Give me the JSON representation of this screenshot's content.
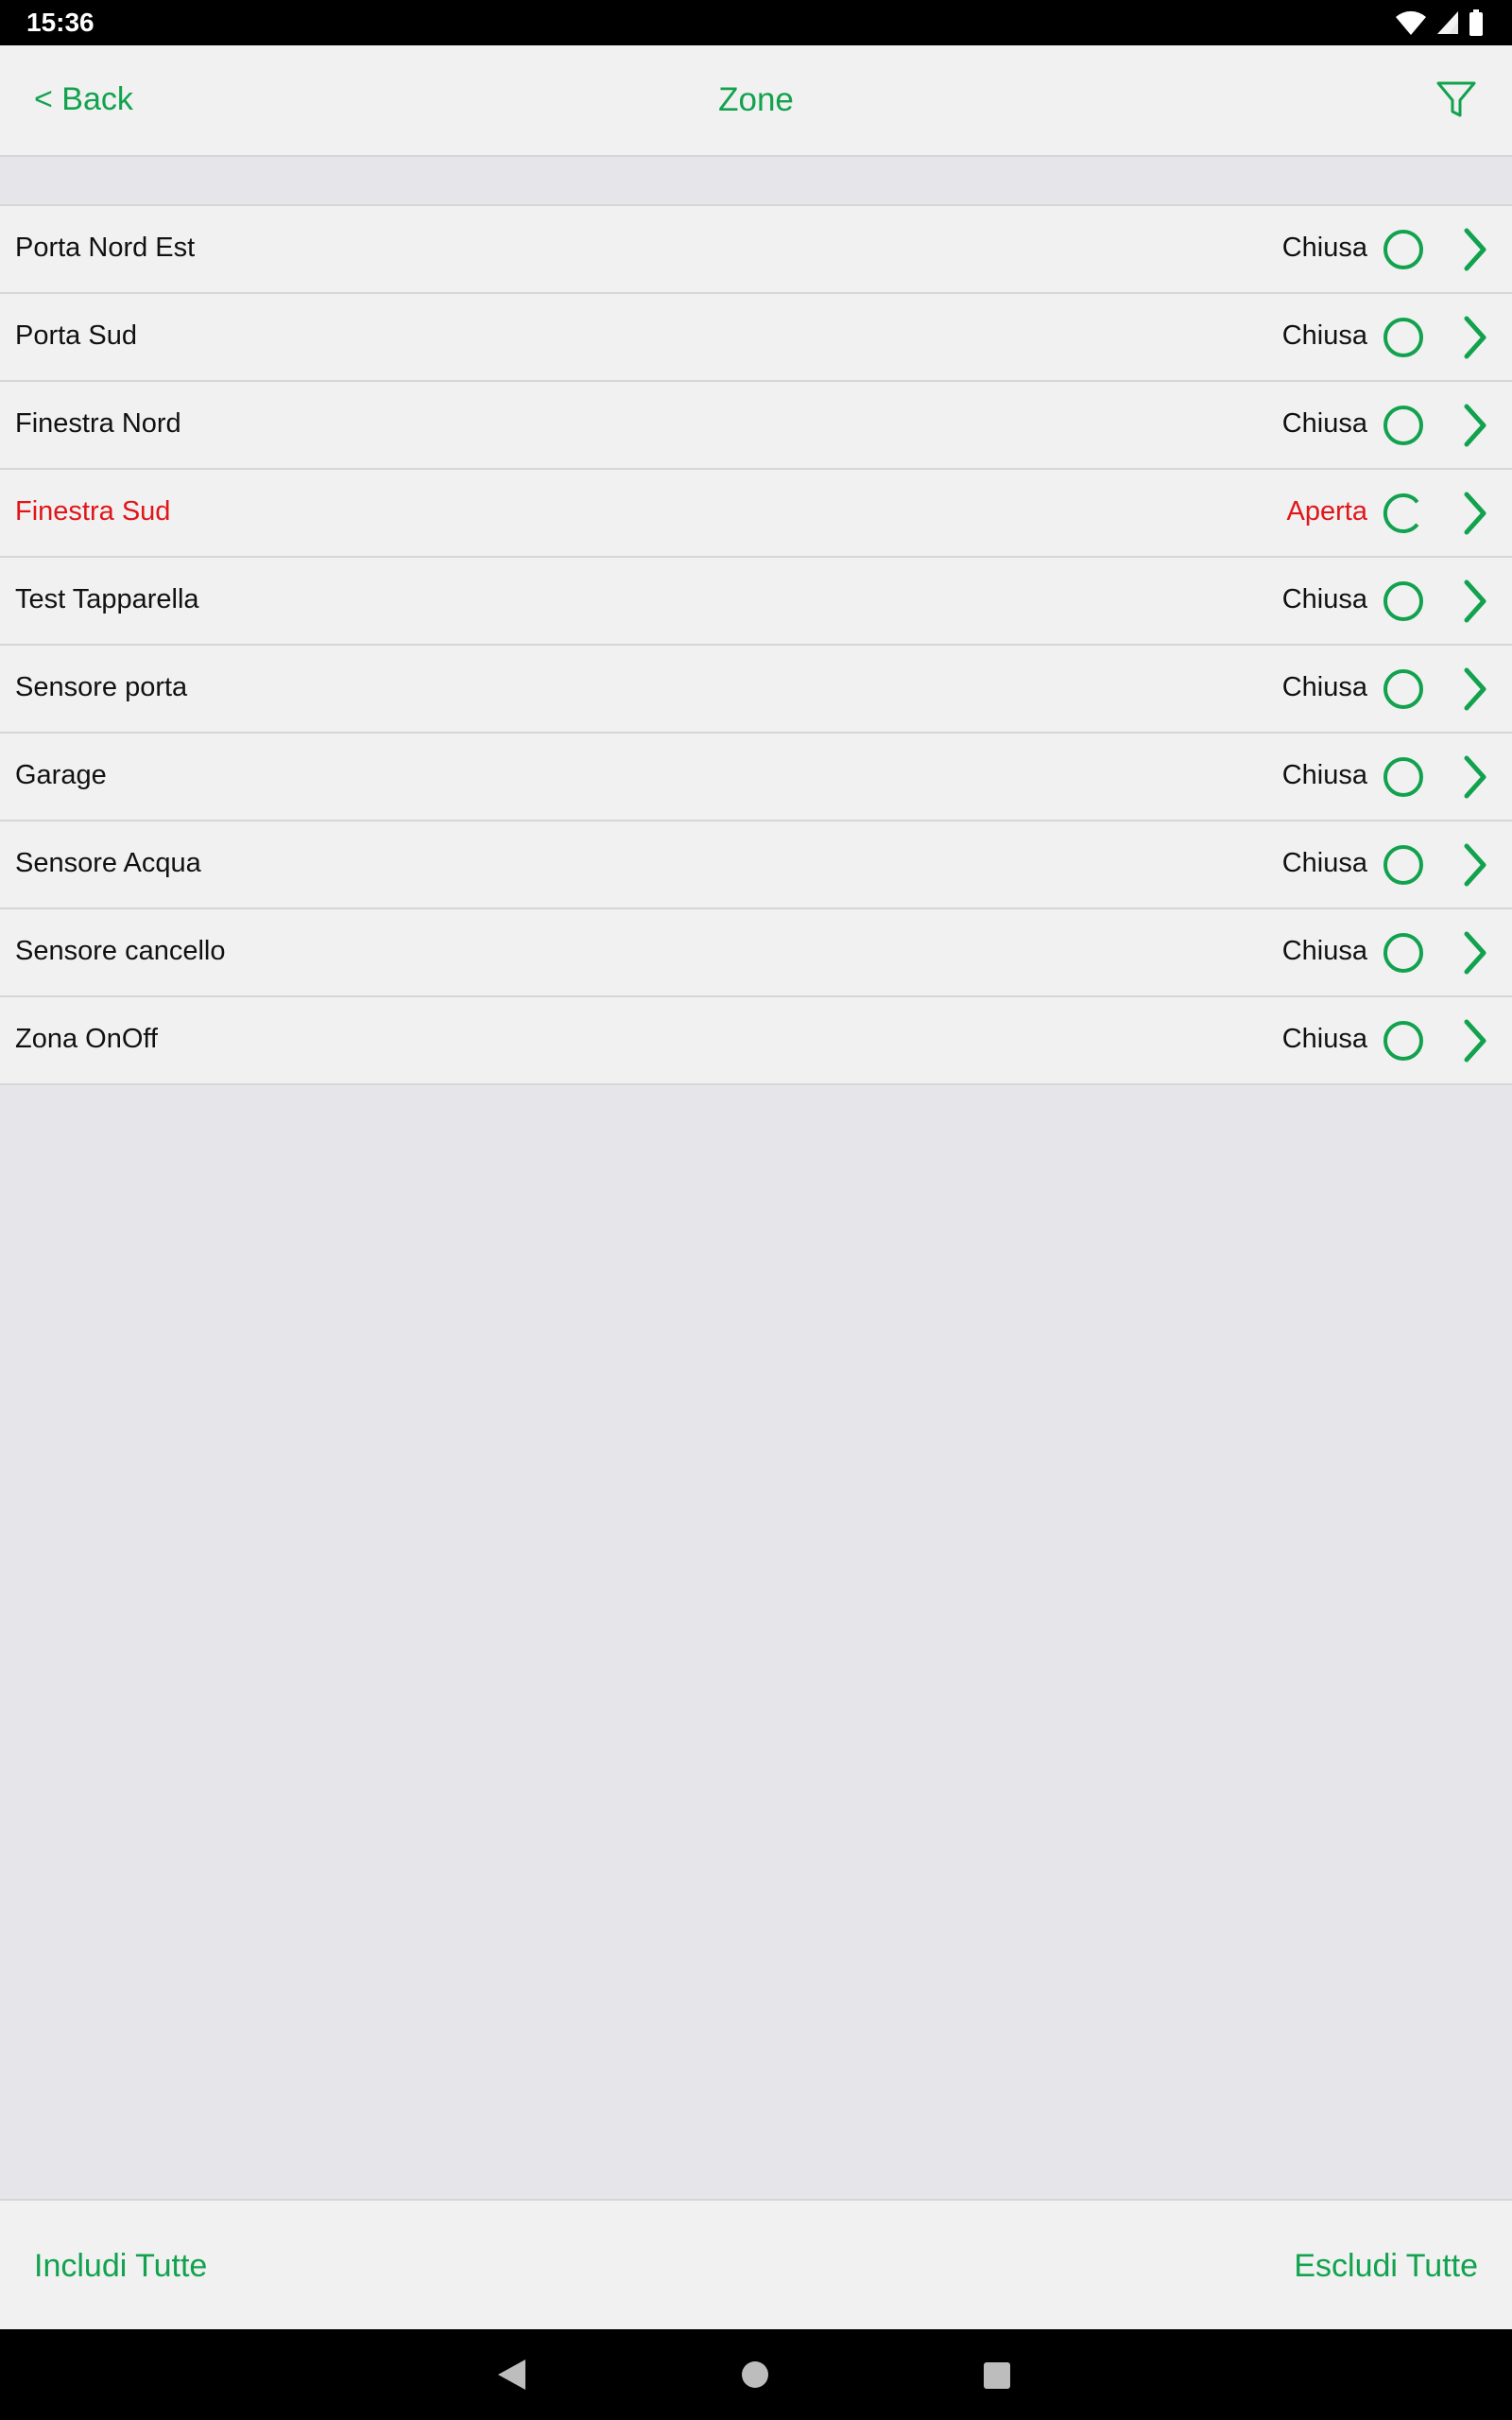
{
  "status_bar": {
    "time": "15:36",
    "icons": [
      "wifi-icon",
      "cell-signal-icon",
      "battery-icon"
    ]
  },
  "header": {
    "back_label": "< Back",
    "title": "Zone",
    "filter_icon": "filter-icon"
  },
  "zones": [
    {
      "name": "Porta Nord Est",
      "status": "Chiusa",
      "state": "closed"
    },
    {
      "name": "Porta Sud",
      "status": "Chiusa",
      "state": "closed"
    },
    {
      "name": "Finestra Nord",
      "status": "Chiusa",
      "state": "closed"
    },
    {
      "name": "Finestra Sud",
      "status": "Aperta",
      "state": "open"
    },
    {
      "name": "Test Tapparella",
      "status": "Chiusa",
      "state": "closed"
    },
    {
      "name": "Sensore porta",
      "status": "Chiusa",
      "state": "closed"
    },
    {
      "name": "Garage",
      "status": "Chiusa",
      "state": "closed"
    },
    {
      "name": "Sensore Acqua",
      "status": "Chiusa",
      "state": "closed"
    },
    {
      "name": "Sensore cancello",
      "status": "Chiusa",
      "state": "closed"
    },
    {
      "name": "Zona OnOff",
      "status": "Chiusa",
      "state": "closed"
    }
  ],
  "footer": {
    "include_all": "Includi Tutte",
    "exclude_all": "Escludi Tutte"
  },
  "system_nav": [
    "back-triangle-icon",
    "home-circle-icon",
    "recents-square-icon"
  ],
  "colors": {
    "accent": "#12a24e",
    "alert": "#e0161b",
    "background": "#e6e6ea",
    "row": "#f0f1f0"
  }
}
